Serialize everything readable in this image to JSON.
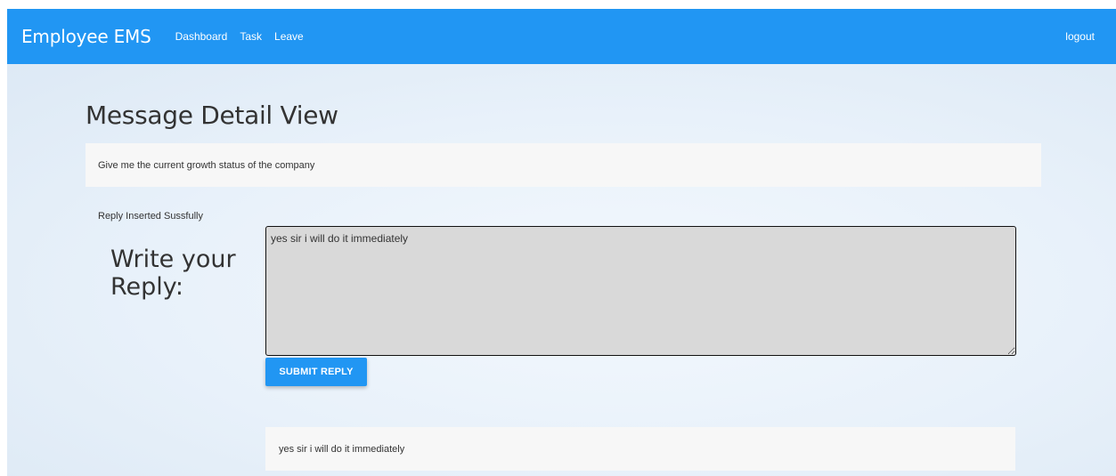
{
  "navbar": {
    "brand": "Employee EMS",
    "links": [
      "Dashboard",
      "Task",
      "Leave"
    ],
    "logout": "logout",
    "color": "#2196f3"
  },
  "page": {
    "title": "Message Detail View",
    "message": "Give me the current growth status of the company",
    "status": "Reply Inserted Sussfully"
  },
  "reply_form": {
    "label": "Write your Reply:",
    "textarea_value": "yes sir i will do it immediately",
    "submit_label": "SUBMIT REPLY"
  },
  "replies": [
    {
      "text": "yes sir i will do it immediately"
    }
  ]
}
